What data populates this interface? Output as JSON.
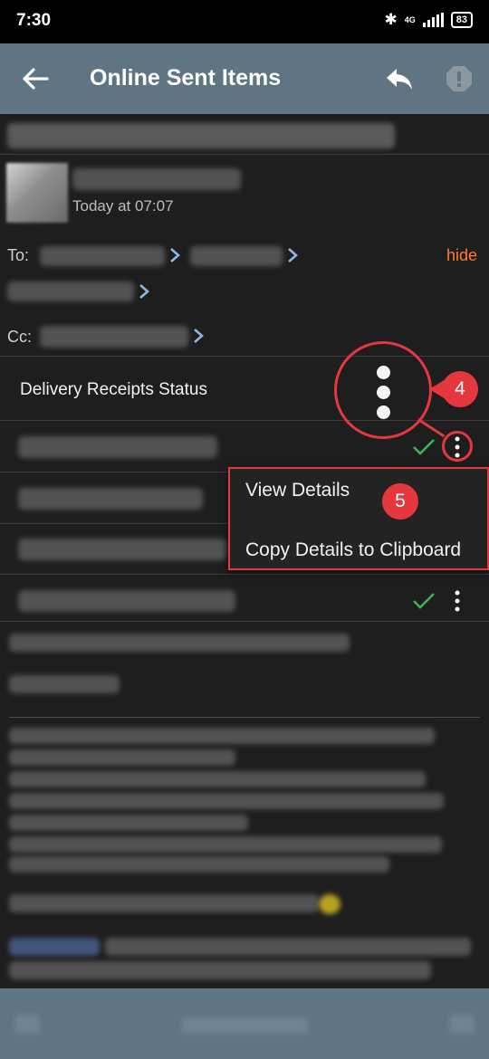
{
  "status_bar": {
    "time": "7:30",
    "network": "4G",
    "battery": "83"
  },
  "header": {
    "title": "Online Sent Items"
  },
  "message": {
    "sent_time": "Today at 07:07",
    "to_label": "To:",
    "cc_label": "Cc:",
    "hide_label": "hide"
  },
  "delivery": {
    "title": "Delivery Receipts Status",
    "rows": [
      {
        "status": "delivered"
      },
      {
        "status": ""
      },
      {
        "status": ""
      },
      {
        "status": "delivered"
      }
    ]
  },
  "context_menu": {
    "items": [
      "View Details",
      "Copy Details to Clipboard"
    ]
  },
  "annotations": {
    "callout_4": "4",
    "callout_5": "5"
  },
  "colors": {
    "accent": "#ff7a33",
    "appbar": "#5f7584",
    "annotation": "#e5383e",
    "check": "#3cb54a",
    "link_chevron": "#8fb6e8"
  },
  "icons": [
    "back-arrow-icon",
    "reply-icon",
    "alert-icon",
    "chevron-right-icon",
    "checkmark-icon",
    "more-vert-icon"
  ]
}
